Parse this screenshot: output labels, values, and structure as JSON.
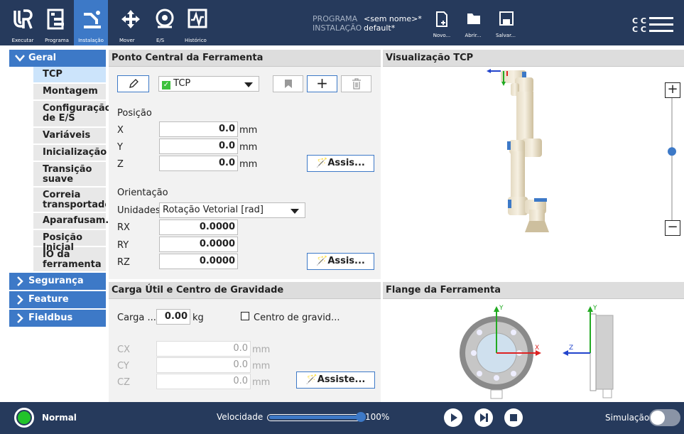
{
  "topbar": {
    "tabs": [
      {
        "label": "Executar",
        "icon": "ur-logo-icon"
      },
      {
        "label": "Programa",
        "icon": "program-icon"
      },
      {
        "label": "Instalação",
        "icon": "installation-icon"
      },
      {
        "label": "Mover",
        "icon": "move-icon"
      },
      {
        "label": "E/S",
        "icon": "io-icon"
      },
      {
        "label": "Histórico",
        "icon": "log-icon"
      }
    ],
    "active_tab": "Instalação",
    "program_key": "PROGRAMA",
    "program_val": "<sem nome>*",
    "install_key": "INSTALAÇÃO",
    "install_val": "default*",
    "file_buttons": [
      {
        "label": "Novo..."
      },
      {
        "label": "Abrir..."
      },
      {
        "label": "Salvar..."
      }
    ],
    "cc_top": "C C",
    "cc_bottom": "C C"
  },
  "sidebar": {
    "geral": "Geral",
    "items": [
      "TCP",
      "Montagem",
      "Configuração de E/S",
      "Variáveis",
      "Inicialização",
      "Transição suave",
      "Correia transportadora",
      "Aparafusam...",
      "Posição Inicial",
      "IO da ferramenta"
    ],
    "selected": "TCP",
    "sections": [
      "Segurança",
      "Feature",
      "Fieldbus"
    ]
  },
  "tcp": {
    "title": "Ponto Central da Ferramenta",
    "tcp_select": "TCP",
    "position_label": "Posição",
    "x_label": "X",
    "x_val": "0.0",
    "x_unit": "mm",
    "y_label": "Y",
    "y_val": "0.0",
    "y_unit": "mm",
    "z_label": "Z",
    "z_val": "0.0",
    "z_unit": "mm",
    "assist1": "Assis...",
    "orientation_label": "Orientação",
    "units_label": "Unidades",
    "units_val": "Rotação Vetorial [rad]",
    "rx_label": "RX",
    "rx_val": "0.0000",
    "ry_label": "RY",
    "ry_val": "0.0000",
    "rz_label": "RZ",
    "rz_val": "0.0000",
    "assist2": "Assis..."
  },
  "viz": {
    "title": "Visualização TCP",
    "zoom_in": "+",
    "zoom_out": "−",
    "zoom_level": 0.55
  },
  "payload": {
    "title": "Carga Útil e Centro de Gravidade",
    "carga_label": "Carga ...",
    "carga_val": "0.00",
    "carga_unit": "kg",
    "cog_label": "Centro de gravid...",
    "cx_label": "CX",
    "cx_val": "0.0",
    "cx_unit": "mm",
    "cy_label": "CY",
    "cy_val": "0.0",
    "cy_unit": "mm",
    "cz_label": "CZ",
    "cz_val": "0.0",
    "cz_unit": "mm",
    "assist": "Assiste..."
  },
  "flange": {
    "title": "Flange da Ferramenta",
    "y": "Y",
    "x": "X",
    "z": "Z"
  },
  "bottombar": {
    "status": "Normal",
    "status_color": "#22c32a",
    "speed_label": "Velocidade",
    "speed_val": "100%",
    "speed_fraction": 1.0,
    "sim_label": "Simulação"
  }
}
